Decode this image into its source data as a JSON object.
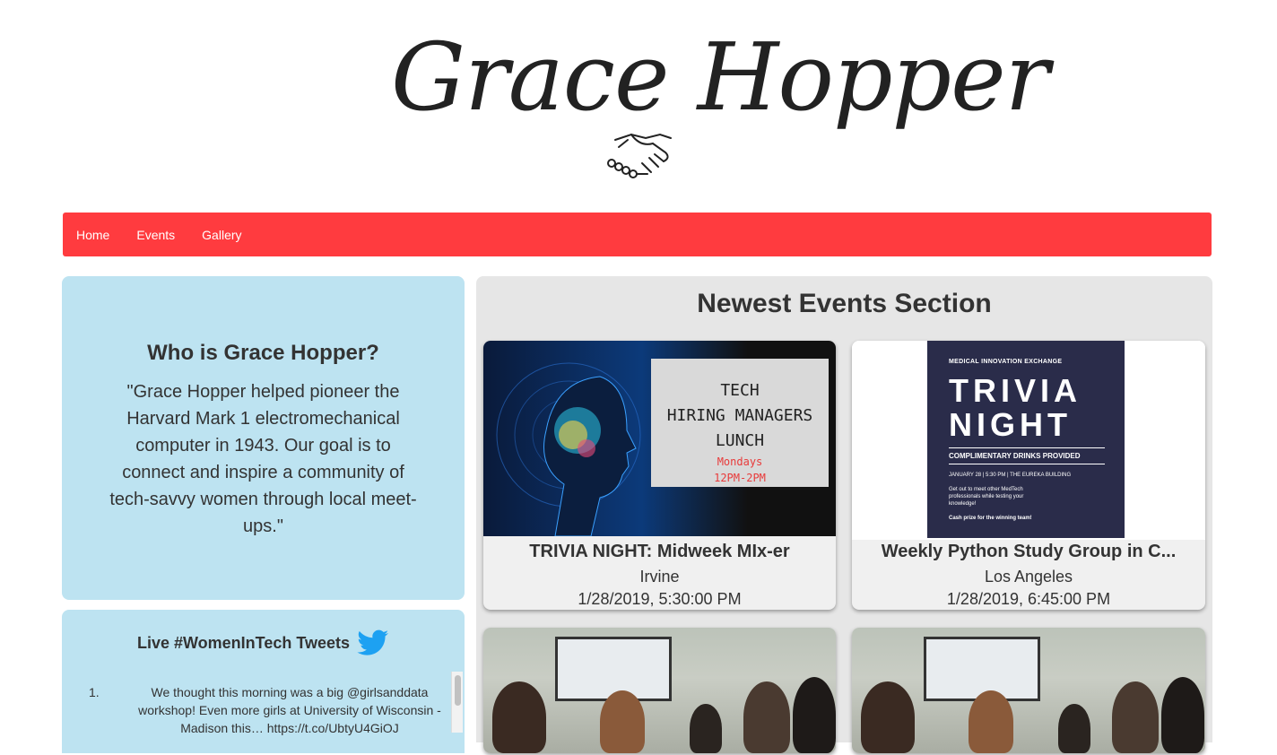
{
  "logo": {
    "text": "Grace Hopper",
    "icon": "handshake-icon"
  },
  "nav": {
    "items": [
      "Home",
      "Events",
      "Gallery"
    ],
    "bg_color": "#ff3b3f"
  },
  "about": {
    "heading": "Who is Grace Hopper?",
    "body": "\"Grace Hopper helped pioneer the Harvard Mark 1 electromechanical computer in 1943. Our goal is to connect and inspire a community of tech-savvy women through local meet-ups.\""
  },
  "tweets": {
    "title": "Live #WomenInTech Tweets",
    "icon": "twitter-bird-icon",
    "items": [
      {
        "num": "1.",
        "text": "We thought this morning was a big @girlsanddata workshop! Even more girls at University of Wisconsin - Madison this… https://t.co/UbtyU4GiOJ"
      }
    ]
  },
  "events": {
    "heading": "Newest Events Section",
    "cards": [
      {
        "title": "TRIVIA NIGHT: Midweek MIx-er",
        "location": "Irvine",
        "date": "1/28/2019, 5:30:00 PM",
        "flyer": {
          "lines": [
            "TECH",
            "HIRING MANAGERS",
            "LUNCH"
          ],
          "sub1": "Mondays",
          "sub2": "12PM-2PM"
        }
      },
      {
        "title": "Weekly Python Study Group in C...",
        "location": "Los Angeles",
        "date": "1/28/2019, 6:45:00 PM",
        "flyer": {
          "top": "MEDICAL INNOVATION EXCHANGE",
          "big1": "TRIVIA",
          "big2": "NIGHT",
          "sub": "COMPLIMENTARY DRINKS PROVIDED",
          "detail": "JANUARY 28 | 5:30 PM | THE EUREKA BUILDING",
          "desc": "Get out to meet other MedTech professionals while testing your knowledge!",
          "prize": "Cash prize for the winning team!"
        }
      }
    ]
  }
}
